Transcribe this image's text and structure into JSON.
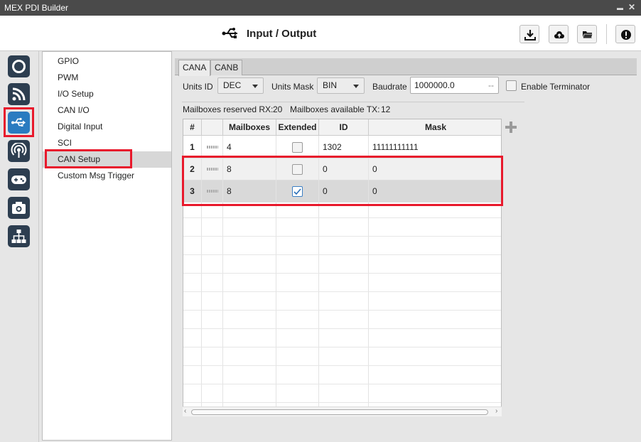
{
  "window": {
    "title": "MEX PDI Builder",
    "minimize": "▬",
    "close": "✕"
  },
  "header": {
    "title": "Input / Output",
    "icon": "usb-icon",
    "buttons": [
      "download-icon",
      "cloud-upload-icon",
      "folder-open-icon",
      "info-icon"
    ]
  },
  "iconbar": {
    "items": [
      "power-icon",
      "rss-icon",
      "usb-icon",
      "broadcast-icon",
      "gamepad-icon",
      "camera-icon",
      "sitemap-icon"
    ],
    "selected_index": 2
  },
  "sidebar": {
    "items": [
      "GPIO",
      "PWM",
      "I/O Setup",
      "CAN I/O",
      "Digital Input",
      "SCI",
      "CAN Setup",
      "Custom Msg Trigger"
    ],
    "selected": "CAN Setup"
  },
  "tabs": [
    "CANA",
    "CANB"
  ],
  "form": {
    "units_id_label": "Units ID",
    "units_id_value": "DEC",
    "units_mask_label": "Units Mask",
    "units_mask_value": "BIN",
    "baudrate_label": "Baudrate",
    "baudrate_value": "1000000.0",
    "baudrate_suffix": "--",
    "terminator_label": "Enable Terminator",
    "terminator_checked": false
  },
  "mailbox_info": {
    "reserved_label": "Mailboxes reserved RX:",
    "reserved_value": "20",
    "available_label": "Mailboxes available TX:",
    "available_value": "12"
  },
  "table": {
    "columns": [
      "#",
      "",
      "Mailboxes",
      "Extended",
      "ID",
      "Mask"
    ],
    "rows": [
      {
        "num": "1",
        "mailboxes": "4",
        "extended": false,
        "id": "1302",
        "mask": "11111111111"
      },
      {
        "num": "2",
        "mailboxes": "8",
        "extended": false,
        "id": "0",
        "mask": "0"
      },
      {
        "num": "3",
        "mailboxes": "8",
        "extended": true,
        "id": "0",
        "mask": "0"
      }
    ],
    "selected_row": "3"
  },
  "colors": {
    "titlebar": "#4a4a4a",
    "icon_bg": "#2d3e50",
    "icon_selected": "#2a7bc0",
    "highlight": "#e8192c"
  }
}
